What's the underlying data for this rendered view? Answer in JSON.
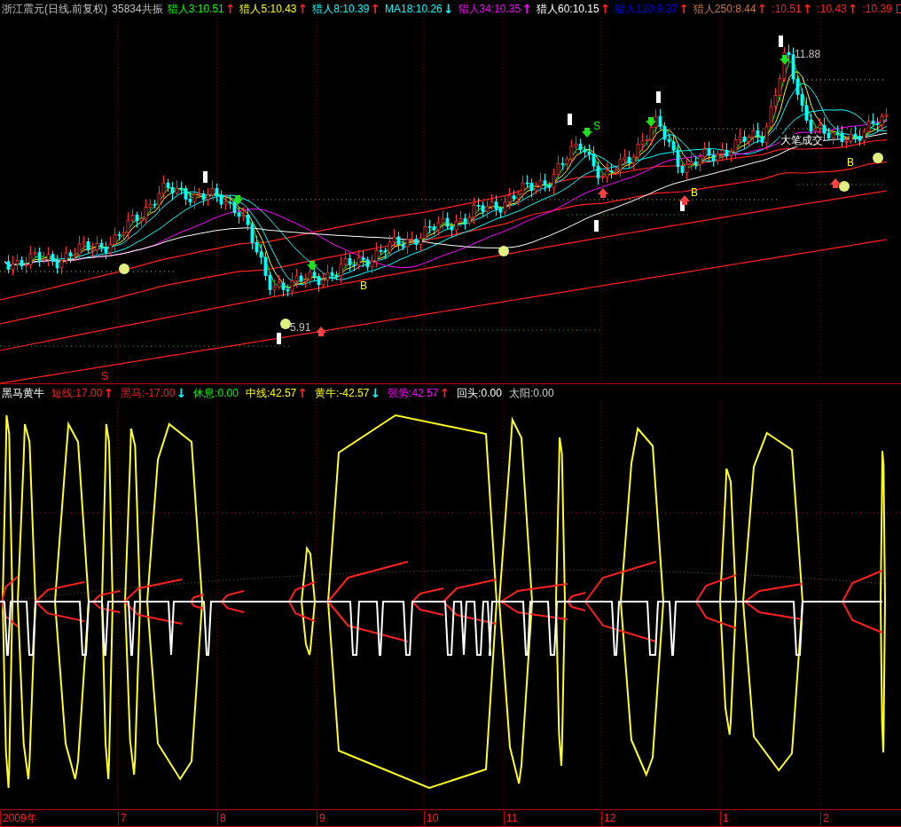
{
  "chart_header": {
    "title": "浙江震元(日线.前复权)",
    "resonance": "35834共振",
    "legend": [
      {
        "label": "猎人3:10.51",
        "color": "#00ff00",
        "arrow": {
          "text": "↑",
          "color": "#ff2020"
        }
      },
      {
        "label": "猎人5:10.43",
        "color": "#ffff00",
        "arrow": {
          "text": "↑",
          "color": "#ff2020"
        }
      },
      {
        "label": "猎人8:10.39",
        "color": "#00ffff",
        "arrow": {
          "text": "↑",
          "color": "#ff2020"
        }
      },
      {
        "label": "MA18:10.26",
        "color": "#00ffff",
        "arrow": {
          "text": "↓",
          "color": "#00ffff"
        }
      },
      {
        "label": "猎人34:10.35",
        "color": "#ff00ff",
        "arrow": {
          "text": "↑",
          "color": "#ff00ff"
        }
      },
      {
        "label": "猎人60:10.15",
        "color": "#ffffff",
        "arrow": {
          "text": "↑",
          "color": "#ff2020"
        }
      },
      {
        "label": "猎人120:9.37",
        "color": "#0000ff",
        "arrow": {
          "text": "↑",
          "color": "#ff2020"
        }
      },
      {
        "label": "猎人250:8.44",
        "color": "#c87840",
        "arrow": {
          "text": "↑",
          "color": "#ff2020"
        }
      },
      {
        "label": ":10.51",
        "color": "#ff2020",
        "arrow": {
          "text": "↑",
          "color": "#ff2020"
        }
      },
      {
        "label": ":10.43",
        "color": "#ff2020",
        "arrow": {
          "text": "↑",
          "color": "#ff2020"
        }
      },
      {
        "label": ":10.39",
        "color": "#ff2020"
      }
    ]
  },
  "price_chart": {
    "labels": [
      {
        "text": "11.88",
        "color": "#c0c0c0"
      },
      {
        "text": "5.91",
        "color": "#c0c0c0"
      },
      {
        "text": "大笔成交",
        "color": "#ffffff"
      },
      {
        "text": "S",
        "color": "#00ff00"
      },
      {
        "text": "B",
        "color": "#ffff00"
      },
      {
        "text": "B",
        "color": "#ffff00"
      },
      {
        "text": "B",
        "color": "#ffff00"
      },
      {
        "text": "S",
        "color": "#ff2020"
      }
    ]
  },
  "indicator_header": {
    "title": "黑马黄牛",
    "legend": [
      {
        "label": "短线:17.00",
        "color": "#ff2020",
        "arrow": {
          "text": "↑",
          "color": "#ff2020"
        }
      },
      {
        "label": "黑马:-17.00",
        "color": "#ff2020",
        "arrow": {
          "text": "↓",
          "color": "#00ffff"
        }
      },
      {
        "label": "休息:0.00",
        "color": "#00ff00"
      },
      {
        "label": "中线:42.57",
        "color": "#ffff00",
        "arrow": {
          "text": "↑",
          "color": "#ff2020"
        }
      },
      {
        "label": "黄牛:-42.57",
        "color": "#ffff00",
        "arrow": {
          "text": "↓",
          "color": "#00ffff"
        }
      },
      {
        "label": "强势:42.57",
        "color": "#ff00ff",
        "arrow": {
          "text": "↑",
          "color": "#ff2020"
        }
      },
      {
        "label": "回头:0.00",
        "color": "#ffffff"
      },
      {
        "label": "太阳:0.00",
        "color": "#d0d0d0"
      }
    ]
  },
  "time_axis": {
    "labels": [
      "2009年",
      "7",
      "8",
      "9",
      "10",
      "11",
      "12",
      "1",
      "2"
    ]
  }
}
